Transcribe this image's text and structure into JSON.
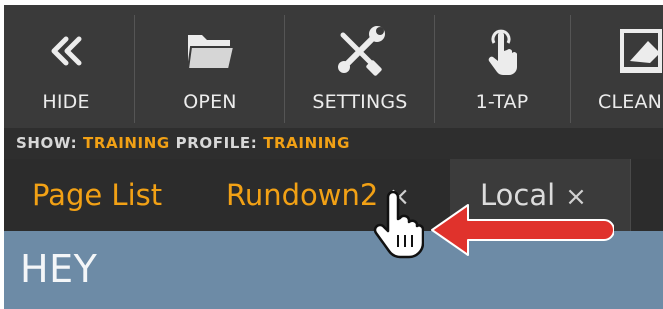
{
  "toolbar": {
    "items": [
      {
        "label": "HIDE",
        "icon": "chevron-double-left-icon"
      },
      {
        "label": "OPEN",
        "icon": "folder-icon"
      },
      {
        "label": "SETTINGS",
        "icon": "tools-icon"
      },
      {
        "label": "1-TAP",
        "icon": "tap-hand-icon"
      },
      {
        "label": "CLEAN",
        "icon": "eraser-icon"
      }
    ]
  },
  "show_bar": {
    "show_key": "SHOW:",
    "show_value": "TRAINING",
    "profile_key": "PROFILE:",
    "profile_value": "TRAINING"
  },
  "tabs": [
    {
      "label": "Page List",
      "closable": false
    },
    {
      "label": "Rundown2",
      "closable": true
    },
    {
      "label": "Local",
      "closable": true
    }
  ],
  "close_glyph": "×",
  "content": {
    "title": "HEY"
  },
  "colors": {
    "accent": "#f2a115",
    "toolbar_bg": "#3a3a3a",
    "content_bg": "#6d8ba6",
    "arrow": "#e0322c"
  },
  "annotations": {
    "pointer": "hand-cursor-icon",
    "arrow": "red-arrow-annotation"
  }
}
